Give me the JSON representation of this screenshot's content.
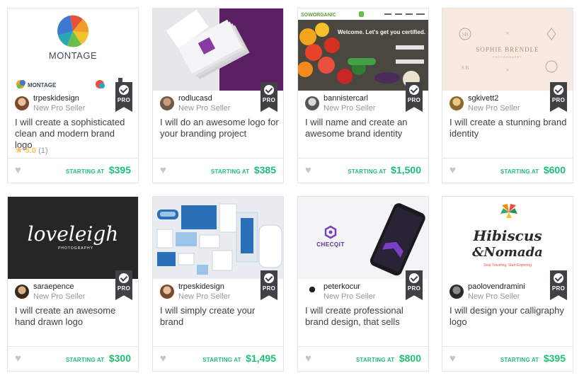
{
  "gigs": [
    {
      "seller": "trpeskidesign",
      "level": "New Pro Seller",
      "title": "I will create a sophisticated clean and modern brand logo",
      "rating": {
        "score": "5.0",
        "count": "(1)"
      },
      "starting_label": "STARTING AT",
      "price": "$395",
      "pro_label": "PRO",
      "thumb_text": "MONTAGE",
      "thumb_text_2": "MONTAGE"
    },
    {
      "seller": "rodlucasd",
      "level": "New Pro Seller",
      "title": "I will do an awesome logo for your branding project",
      "starting_label": "STARTING AT",
      "price": "$385",
      "pro_label": "PRO"
    },
    {
      "seller": "bannistercarl",
      "level": "New Pro Seller",
      "title": "I will name and create an awesome brand identity",
      "starting_label": "STARTING AT",
      "price": "$1,500",
      "pro_label": "PRO",
      "thumb_text": "SOWORGANIC",
      "thumb_text_2": "Welcome. Let's get you certified."
    },
    {
      "seller": "sgkivett2",
      "level": "New Pro Seller",
      "title": "I will create a stunning brand identity",
      "starting_label": "STARTING AT",
      "price": "$600",
      "pro_label": "PRO",
      "thumb_text": "SOPHIE BRENDLE",
      "thumb_text_2": "PHOTOGRAPHY"
    },
    {
      "seller": "saraepence",
      "level": "New Pro Seller",
      "title": "I will create an awesome hand drawn logo",
      "starting_label": "STARTING AT",
      "price": "$300",
      "pro_label": "PRO",
      "thumb_text": "loveleigh",
      "thumb_text_2": "PHOTOGRAPHY"
    },
    {
      "seller": "trpeskidesign",
      "level": "New Pro Seller",
      "title": "I will simply create your brand",
      "starting_label": "STARTING AT",
      "price": "$1,495",
      "pro_label": "PRO"
    },
    {
      "seller": "peterkocur",
      "level": "New Pro Seller",
      "title": "I will create professional brand design, that sells",
      "starting_label": "STARTING AT",
      "price": "$800",
      "pro_label": "PRO",
      "thumb_text": "CHECQIT"
    },
    {
      "seller": "paolovendramini",
      "level": "New Pro Seller",
      "title": "I will design your calligraphy logo",
      "starting_label": "STARTING AT",
      "price": "$395",
      "pro_label": "PRO",
      "thumb_text": "Hibiscus",
      "thumb_text_2": "&Nomada",
      "thumb_text_3": "Stop Traveling. Start Exploring"
    }
  ],
  "colors": {
    "accent": "#1dbf73",
    "star": "#ffbe5b",
    "badge": "#404145"
  }
}
